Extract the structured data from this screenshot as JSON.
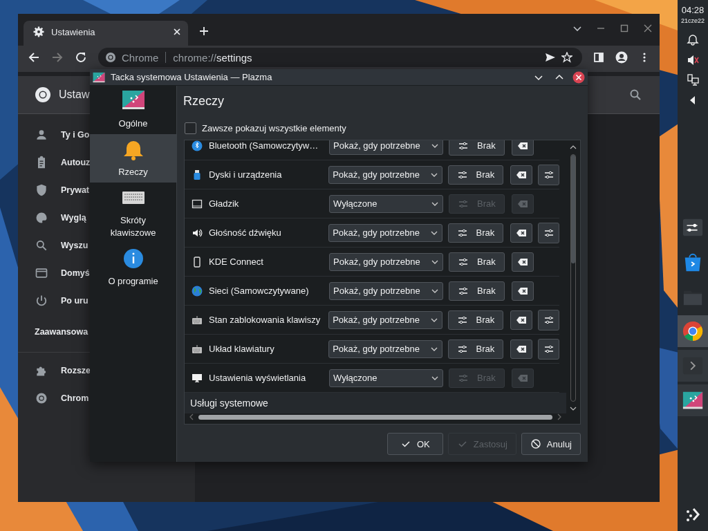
{
  "panel": {
    "clock": "04:28",
    "date": "21cze22",
    "tray": [
      {
        "muted": false
      },
      {
        "muted": true
      },
      {
        "muted": false
      },
      {
        "muted": false
      }
    ],
    "tasks": [
      {
        "running": false,
        "selected": false
      },
      {
        "running": false,
        "selected": false
      },
      {
        "running": false,
        "selected": false
      },
      {
        "running": true,
        "selected": true
      },
      {
        "running": true,
        "selected": false
      },
      {
        "running": true,
        "selected": false
      }
    ]
  },
  "browser": {
    "tab": {
      "label": "Ustawienia"
    },
    "omnibox": {
      "site": "Chrome",
      "url_scheme": "chrome://",
      "url_path": "settings"
    },
    "header": {
      "title": "Ustaw"
    },
    "sidebar": {
      "items": [
        {
          "label": "Ty i Go"
        },
        {
          "label": "Autouz"
        },
        {
          "label": "Prywat"
        },
        {
          "label": "Wyglą"
        },
        {
          "label": "Wyszu"
        },
        {
          "label": "Domyś"
        },
        {
          "label": "Po uru"
        }
      ],
      "section": "Zaawansowa",
      "bottom_items": [
        {
          "label": "Rozsze"
        },
        {
          "label": "Chrom"
        }
      ]
    }
  },
  "dialog": {
    "title": "Tacka systemowa Ustawienia — Plazma",
    "nav": [
      {
        "label": "Ogólne",
        "selected": false
      },
      {
        "label": "Rzeczy",
        "selected": true
      },
      {
        "label": "Skróty klawiszowe",
        "selected": false
      },
      {
        "label": "O programie",
        "selected": false
      }
    ],
    "heading": "Rzeczy",
    "show_all": {
      "label": "Zawsze pokazuj wszystkie elementy",
      "checked": false
    },
    "rows": [
      {
        "name": "Bluetooth (Samowczytyw…",
        "visibility": "Pokaż, gdy potrzebne",
        "shortcut": "Brak",
        "disabled": false,
        "configurable": false
      },
      {
        "name": "Dyski i urządzenia",
        "visibility": "Pokaż, gdy potrzebne",
        "shortcut": "Brak",
        "disabled": false,
        "configurable": true
      },
      {
        "name": "Gładzik",
        "visibility": "Wyłączone",
        "shortcut": "Brak",
        "disabled": true,
        "configurable": false
      },
      {
        "name": "Głośność dźwięku",
        "visibility": "Pokaż, gdy potrzebne",
        "shortcut": "Brak",
        "disabled": false,
        "configurable": true
      },
      {
        "name": "KDE Connect",
        "visibility": "Pokaż, gdy potrzebne",
        "shortcut": "Brak",
        "disabled": false,
        "configurable": false
      },
      {
        "name": "Sieci (Samowczytywane)",
        "visibility": "Pokaż, gdy potrzebne",
        "shortcut": "Brak",
        "disabled": false,
        "configurable": false
      },
      {
        "name": "Stan zablokowania klawiszy",
        "visibility": "Pokaż, gdy potrzebne",
        "shortcut": "Brak",
        "disabled": false,
        "configurable": true
      },
      {
        "name": "Układ klawiatury",
        "visibility": "Pokaż, gdy potrzebne",
        "shortcut": "Brak",
        "disabled": false,
        "configurable": true
      },
      {
        "name": "Ustawienia wyświetlania",
        "visibility": "Wyłączone",
        "shortcut": "Brak",
        "disabled": true,
        "configurable": false
      }
    ],
    "section": "Usługi systemowe",
    "buttons": [
      {
        "label": "OK",
        "disabled": false
      },
      {
        "label": "Zastosuj",
        "disabled": true
      },
      {
        "label": "Anuluj",
        "disabled": false
      }
    ]
  }
}
